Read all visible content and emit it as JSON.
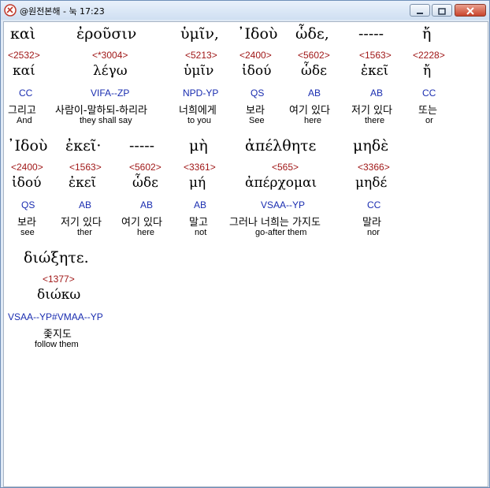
{
  "window": {
    "title": "@원전본해 - 눅 17:23"
  },
  "controls": {
    "minimize_icon": "minimize-icon",
    "maximize_icon": "maximize-icon",
    "close_icon": "close-icon"
  },
  "words": [
    {
      "greek": "καὶ",
      "strong": "<2532>",
      "lemma": "καί",
      "morph": "CC",
      "korean": "그리고",
      "english": "And"
    },
    {
      "greek": "ἐροῦσιν",
      "strong": "<*3004>",
      "lemma": "λέγω",
      "morph": "VIFA--ZP",
      "korean": "사람이-말하되-하리라",
      "english": "they shall say"
    },
    {
      "greek": "ὑμῖν,",
      "strong": "<5213>",
      "lemma": "ὑμῖν",
      "morph": "NPD-YP",
      "korean": "너희에게",
      "english": "to you"
    },
    {
      "greek": "᾿Ιδοὺ",
      "strong": "<2400>",
      "lemma": "ἰδού",
      "morph": "QS",
      "korean": "보라",
      "english": "See"
    },
    {
      "greek": "ὧδε,",
      "strong": "<5602>",
      "lemma": "ὧδε",
      "morph": "AB",
      "korean": "여기 있다",
      "english": "here"
    },
    {
      "greek": "-----",
      "strong": "<1563>",
      "lemma": "ἐκεῖ",
      "morph": "AB",
      "korean": "저기 있다",
      "english": "there"
    },
    {
      "greek": "ἤ",
      "strong": "<2228>",
      "lemma": "ἤ",
      "morph": "CC",
      "korean": "또는",
      "english": "or"
    },
    {
      "greek": "᾿Ιδοὺ",
      "strong": "<2400>",
      "lemma": "ἰδού",
      "morph": "QS",
      "korean": "보라",
      "english": "see"
    },
    {
      "greek": "ἐκεῖ·",
      "strong": "<1563>",
      "lemma": "ἐκεῖ",
      "morph": "AB",
      "korean": "저기 있다",
      "english": "ther"
    },
    {
      "greek": "-----",
      "strong": "<5602>",
      "lemma": "ὧδε",
      "morph": "AB",
      "korean": "여기 있다",
      "english": "here"
    },
    {
      "greek": "μὴ",
      "strong": "<3361>",
      "lemma": "μή",
      "morph": "AB",
      "korean": "말고",
      "english": "not"
    },
    {
      "greek": "ἀπέλθητε",
      "strong": "<565>",
      "lemma": "ἀπέρχομαι",
      "morph": "VSAA--YP",
      "korean": "그러나 너희는 가지도",
      "english": "go-after them"
    },
    {
      "greek": "μηδὲ",
      "strong": "<3366>",
      "lemma": "μηδέ",
      "morph": "CC",
      "korean": "말라",
      "english": "nor"
    },
    {
      "greek": "διώξητε.",
      "strong": "<1377>",
      "lemma": "διώκω",
      "morph": "VSAA--YP#VMAA--YP",
      "korean": "좇지도",
      "english": "follow them"
    }
  ]
}
